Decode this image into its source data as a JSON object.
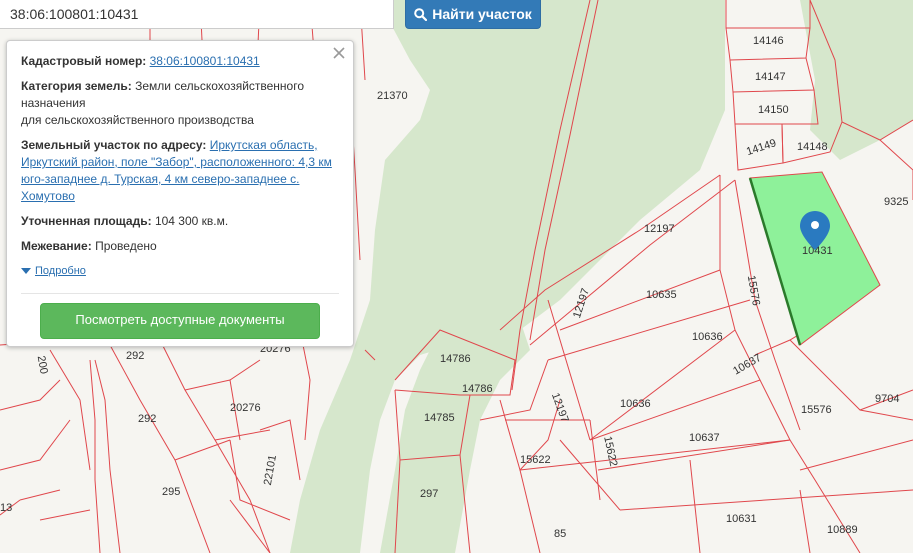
{
  "search": {
    "value": "38:06:100801:10431",
    "button_label": "Найти участок"
  },
  "popup": {
    "cadastral_label": "Кадастровый номер:",
    "cadastral_value": "38:06:100801:10431",
    "category_label": "Категория земель:",
    "category_value_1": "Земли сельскохозяйственного назначения",
    "category_value_2": "для сельскохозяйственного производства",
    "address_label": "Земельный участок по адресу:",
    "address_value": "Иркутская область, Иркутский район, поле \"Забор\", расположенного: 4,3 км юго-западнее д. Турская, 4 км северо-западнее с. Хомутово",
    "area_label": "Уточненная площадь:",
    "area_value": "104 300 кв.м.",
    "survey_label": "Межевание:",
    "survey_value": "Проведено",
    "details_link": "Подробно",
    "docs_button": "Посмотреть доступные документы"
  },
  "map": {
    "plot_labels": [
      "14146",
      "14147",
      "14150",
      "14149",
      "14148",
      "9325",
      "10431",
      "21370",
      "12197",
      "10635",
      "12197",
      "15576",
      "10636",
      "10637",
      "9704",
      "15576",
      "14786",
      "14786",
      "14785",
      "12197",
      "10636",
      "10637",
      "15622",
      "15622",
      "20276",
      "292",
      "292",
      "20276",
      "22101",
      "295",
      "297",
      "85",
      "10631",
      "10889",
      "200",
      "13"
    ],
    "colors": {
      "forest": "#d6e7cc",
      "field": "#f6f5f1",
      "boundary": "#e0474c",
      "selected_fill": "#8ef19a",
      "selected_edge": "#2b7a2b",
      "marker": "#2a7ac0"
    }
  }
}
